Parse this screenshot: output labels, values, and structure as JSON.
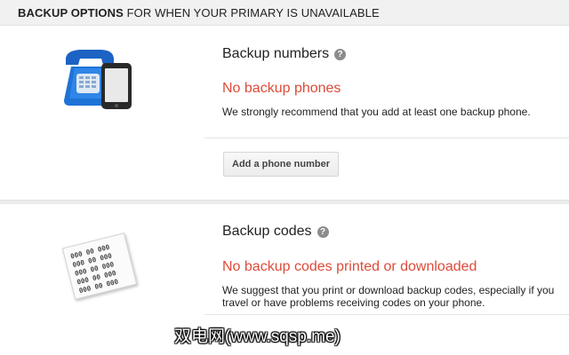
{
  "header": {
    "title_bold": "BACKUP OPTIONS",
    "title_rest": " FOR WHEN YOUR PRIMARY IS UNAVAILABLE"
  },
  "backup_numbers": {
    "title": "Backup numbers",
    "help_glyph": "?",
    "status": "No backup phones",
    "description": "We strongly recommend that you add at least one backup phone.",
    "button_label": "Add a phone number",
    "icon": "telephone-and-phone-icon"
  },
  "backup_codes": {
    "title": "Backup codes",
    "help_glyph": "?",
    "status": "No backup codes printed or downloaded",
    "description": "We suggest that you print or download backup codes, especially if you travel or have problems receiving codes on your phone.",
    "code_lines": [
      "000 00 000",
      "000 00 000",
      "000 00 000",
      "000 00 000",
      "000 00 000"
    ],
    "icon": "backup-codes-sheet-icon"
  },
  "watermark": {
    "text": "双电网(www.sqsp.me)"
  },
  "colors": {
    "warning": "#dd4b39",
    "phone_blue": "#1e73d6",
    "header_bg": "#f1f1f1"
  }
}
